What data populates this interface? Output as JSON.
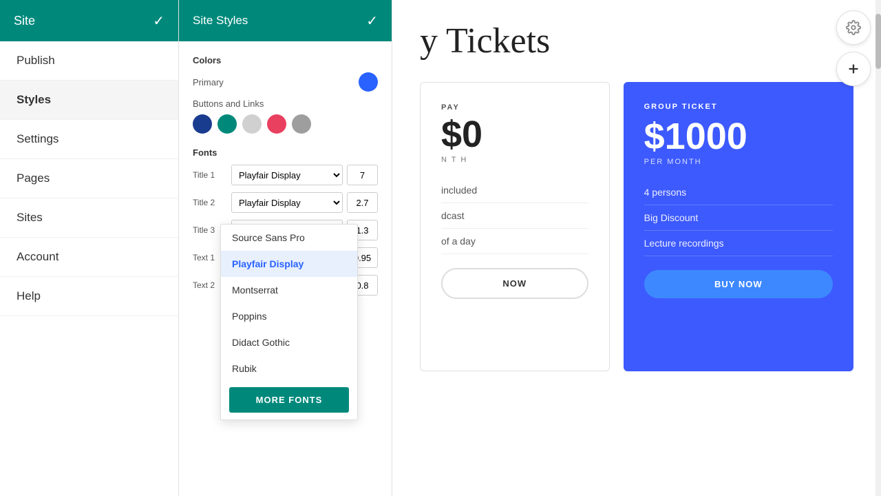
{
  "sidebar": {
    "title": "Site",
    "check": "✓",
    "items": [
      {
        "id": "publish",
        "label": "Publish",
        "active": false
      },
      {
        "id": "styles",
        "label": "Styles",
        "active": true
      },
      {
        "id": "settings",
        "label": "Settings",
        "active": false
      },
      {
        "id": "pages",
        "label": "Pages",
        "active": false
      },
      {
        "id": "sites",
        "label": "Sites",
        "active": false
      },
      {
        "id": "account",
        "label": "Account",
        "active": false
      },
      {
        "id": "help",
        "label": "Help",
        "active": false
      }
    ]
  },
  "styles_panel": {
    "title": "Site Styles",
    "check": "✓",
    "colors": {
      "section_label": "Colors",
      "primary_label": "Primary",
      "primary_color": "#2962ff",
      "buttons_links_label": "Buttons and  Links",
      "swatches": [
        {
          "id": "dark-blue",
          "color": "#1a3c8f"
        },
        {
          "id": "teal",
          "color": "#00897b"
        },
        {
          "id": "light-gray",
          "color": "#d0d0d0"
        },
        {
          "id": "pink-red",
          "color": "#e94060"
        },
        {
          "id": "medium-gray",
          "color": "#9e9e9e"
        }
      ]
    },
    "fonts": {
      "section_label": "Fonts",
      "rows": [
        {
          "id": "title1",
          "label": "Title 1",
          "font": "Playfair Display",
          "size": "7"
        },
        {
          "id": "title2",
          "label": "Title 2",
          "font": "",
          "size": "2.7"
        },
        {
          "id": "title3",
          "label": "Title 3",
          "font": "",
          "size": "1.3"
        },
        {
          "id": "text1",
          "label": "Text 1",
          "font": "",
          "size": "0.95"
        },
        {
          "id": "text2",
          "label": "Text 2",
          "font": "",
          "size": "0.8"
        }
      ]
    }
  },
  "font_dropdown": {
    "options": [
      {
        "id": "source-sans-pro",
        "label": "Source Sans Pro",
        "selected": false
      },
      {
        "id": "playfair-display",
        "label": "Playfair Display",
        "selected": true
      },
      {
        "id": "montserrat",
        "label": "Montserrat",
        "selected": false
      },
      {
        "id": "poppins",
        "label": "Poppins",
        "selected": false
      },
      {
        "id": "didact-gothic",
        "label": "Didact Gothic",
        "selected": false
      },
      {
        "id": "rubik",
        "label": "Rubik",
        "selected": false
      }
    ],
    "more_fonts_label": "MORE FONTS"
  },
  "main": {
    "page_title": "y Tickets",
    "white_card": {
      "type_label": "PAY",
      "price": "0",
      "currency": "$",
      "period": "N T H",
      "features": [
        "included",
        "dcast",
        "of a day"
      ],
      "buy_label": "NOW"
    },
    "blue_card": {
      "type_label": "GROUP TICKET",
      "price": "1000",
      "currency": "$",
      "period": "PER MONTH",
      "features": [
        "4 persons",
        "Big Discount",
        "Lecture recordings"
      ],
      "buy_label": "BUY NOW"
    }
  }
}
